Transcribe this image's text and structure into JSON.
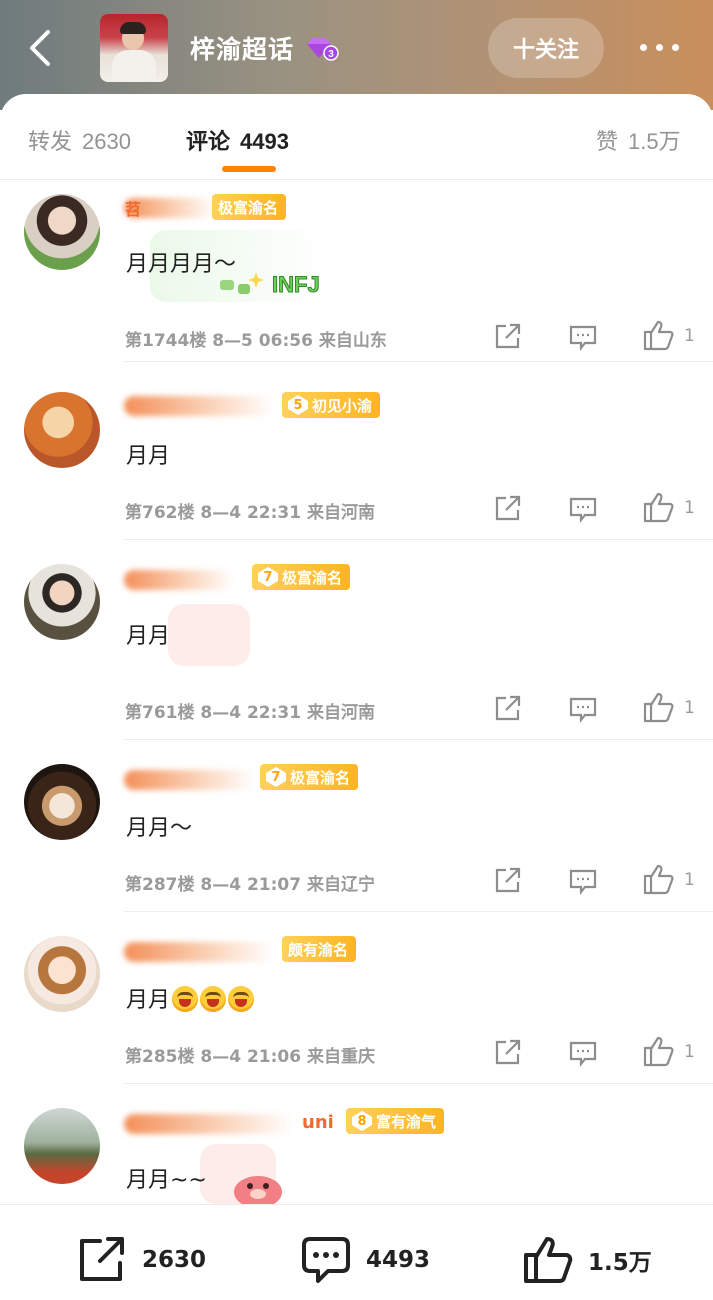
{
  "header": {
    "title": "梓渝超话",
    "vip_level": "3",
    "follow_label": "十关注",
    "back_icon": "chevron-left-icon",
    "more_icon": "more-dots-icon"
  },
  "tabs": {
    "repost": {
      "label": "转发",
      "count": "2630"
    },
    "comment": {
      "label": "评论",
      "count": "4493"
    },
    "like": {
      "label": "赞",
      "count": "1.5万"
    },
    "accent_color": "#ff8200"
  },
  "comments": [
    {
      "name_prefix": "苕",
      "badge_level": "",
      "badge_label": "极富渝名",
      "text": "月月月月～",
      "meta": "第1744楼  8—5  06:56  来自山东",
      "likes": "1",
      "sticker": "INFJ"
    },
    {
      "name_prefix": "",
      "badge_level": "5",
      "badge_label": "初见小渝",
      "text": "月月",
      "meta": "第762楼  8—4  22:31  来自河南",
      "likes": "1"
    },
    {
      "name_prefix": "",
      "badge_level": "7",
      "badge_label": "极富渝名",
      "text": "月月",
      "meta": "第761楼  8—4  22:31  来自河南",
      "likes": "1"
    },
    {
      "name_prefix": "",
      "badge_level": "7",
      "badge_label": "极富渝名",
      "text": "月月～",
      "meta": "第287楼  8—4  21:07  来自辽宁",
      "likes": "1"
    },
    {
      "name_prefix": "",
      "badge_level": "",
      "badge_label": "颇有渝名",
      "text": "月月",
      "meta": "第285楼  8—4  21:06  来自重庆",
      "likes": "1"
    },
    {
      "name_prefix": "",
      "name_suffix": "uni",
      "badge_level": "8",
      "badge_label": "富有渝气",
      "text": "月月~~",
      "meta": "",
      "likes": ""
    }
  ],
  "bottom_bar": {
    "repost_count": "2630",
    "comment_count": "4493",
    "like_count": "1.5万"
  }
}
